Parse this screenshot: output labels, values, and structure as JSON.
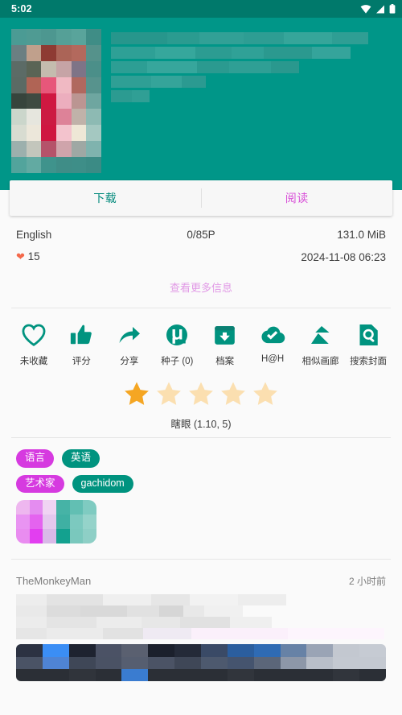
{
  "statusbar": {
    "time": "5:02",
    "icons": [
      "wifi-icon",
      "signal-icon",
      "battery-icon"
    ]
  },
  "header": {
    "thumbnail": "gallery-cover-thumbnail",
    "title": "",
    "background_color": "#009688"
  },
  "action_card": {
    "download_label": "下载",
    "read_label": "阅读",
    "download_color": "#00897b",
    "read_color": "#d84fd8"
  },
  "info": {
    "language": "English",
    "pages": "0/85P",
    "size": "131.0 MiB",
    "favorite_icon": "heart-icon",
    "favorite_count": "15",
    "posted": "2024-11-08 06:23",
    "more_info_label": "查看更多信息"
  },
  "actions": [
    {
      "icon": "heart-outline-icon",
      "label": "未收藏"
    },
    {
      "icon": "thumbs-up-icon",
      "label": "评分"
    },
    {
      "icon": "share-icon",
      "label": "分享"
    },
    {
      "icon": "torrent-icon",
      "label": "种子 (0)"
    },
    {
      "icon": "archive-download-icon",
      "label": "档案"
    },
    {
      "icon": "cloud-check-icon",
      "label": "H@H"
    },
    {
      "icon": "similar-gallery-icon",
      "label": "相似画廊"
    },
    {
      "icon": "search-cover-icon",
      "label": "搜索封面"
    }
  ],
  "rating": {
    "stars_total": 5,
    "stars_filled": 1,
    "filled_color": "#f5a623",
    "empty_color": "#fbdfb0",
    "text": "瞎眼 (1.10, 5)"
  },
  "tags": {
    "rows": [
      {
        "key": "语言",
        "value": "英语"
      },
      {
        "key": "艺术家",
        "value": "gachidom"
      },
      {
        "key": "",
        "value": "",
        "censored": true
      }
    ]
  },
  "comments": [
    {
      "user": "TheMonkeyMan",
      "time": "2 小时前",
      "body": ""
    }
  ],
  "colors": {
    "accent_teal": "#009688",
    "accent_magenta": "#d63ae0",
    "status_bar": "#00796b",
    "page_bg": "#fafafa"
  }
}
